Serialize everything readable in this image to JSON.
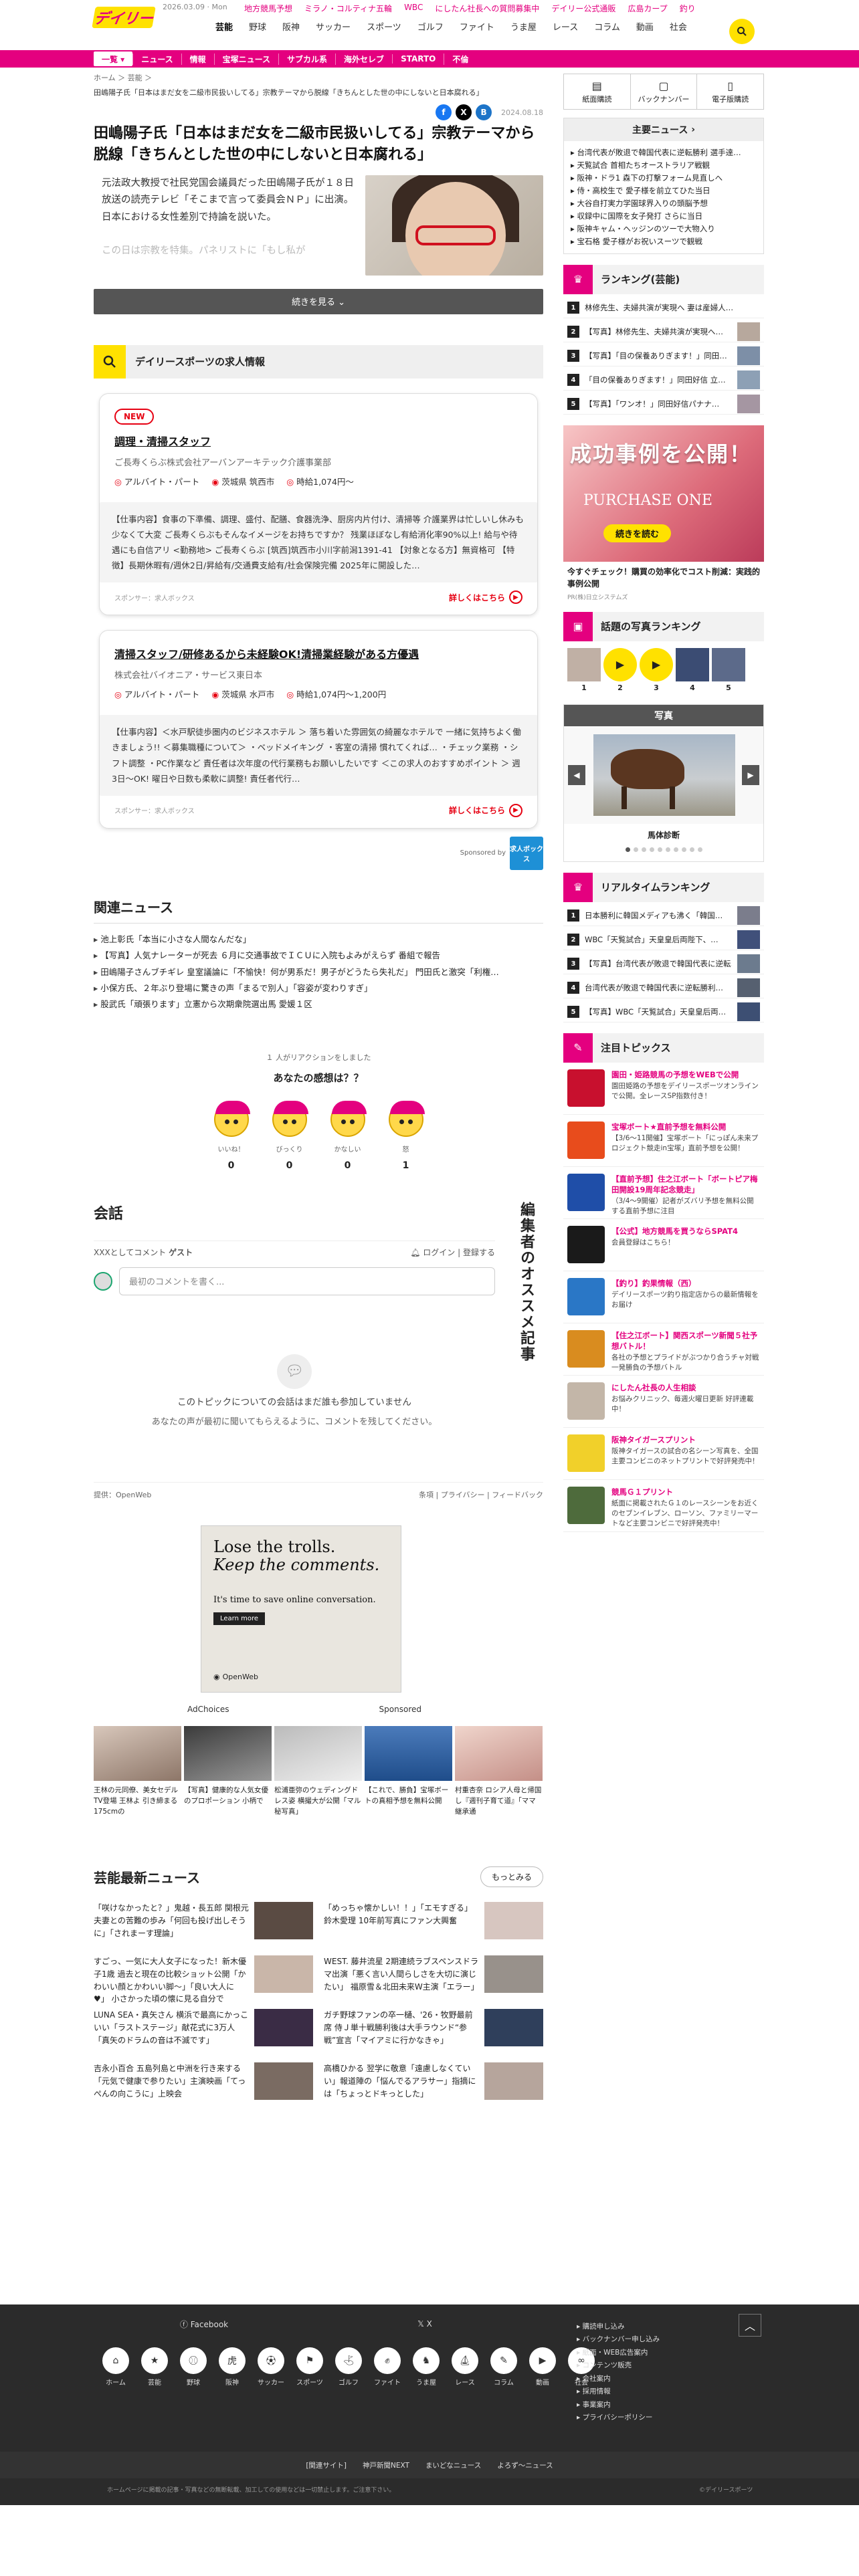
{
  "header": {
    "logo_text": "デイリー",
    "date": "2026.03.09 · Mon",
    "top_links": [
      "地方競馬予想",
      "ミラノ・コルティナ五輪",
      "WBC",
      "にしたん社長への質問募集中",
      "デイリー公式通販",
      "広島カープ",
      "釣り"
    ],
    "gnav": [
      "芸能",
      "野球",
      "阪神",
      "サッカー",
      "スポーツ",
      "ゴルフ",
      "ファイト",
      "うま屋",
      "レース",
      "コラム",
      "動画",
      "社会"
    ],
    "pinkbar": [
      "一覧 ▾",
      "ニュース",
      "情報",
      "宝塚ニュース",
      "サブカル系",
      "海外セレブ",
      "STARTO",
      "不倫"
    ]
  },
  "article": {
    "breadcrumb": "ホーム ＞ 芸能 ＞",
    "breadcrumb_title": "田嶋陽子氏「日本はまだ女を二級市民扱いしてる」宗教テーマから脱線「きちんとした世の中にしないと日本腐れる」",
    "date": "2024.08.18",
    "headline": "田嶋陽子氏「日本はまだ女を二級市民扱いしてる」宗教テーマから脱線「きちんとした世の中にしないと日本腐れる」",
    "lead": "元法政大教授で社民党国会議員だった田嶋陽子氏が１８日放送の読売テレビ「そこまで言って委員会ＮＰ」に出演。日本における女性差別で持論を説いた。",
    "lead_fade": "この日は宗教を特集。パネリストに「もし私が",
    "continue": "続きを見る ⌄"
  },
  "jobs": {
    "title": "デイリースポーツの求人情報",
    "items": [
      {
        "badge": "NEW",
        "title": "調理・清掃スタッフ",
        "company": "ご長寿くらぶ株式会社アーバンアーキテック介護事業部",
        "type": "アルバイト・パート",
        "place": "茨城県 筑西市",
        "wage": "時給1,074円～",
        "desc": "【仕事内容】食事の下準備、調理、盛付、配膳、食器洗浄、厨房内片付け、清掃等 介護業界は忙しいし休みも少なくて大変 ご長寿くらぶもそんなイメージをお持ちですか？ 残業ほぼなし有給消化率90%以上! 給与や待遇にも自信アリ <勤務地> ご長寿くらぶ [筑西]筑西市小川字前潟1391-41 【対象となる方】無資格可 【特徴】長期休暇有/週休2日/昇給有/交通費支給有/社会保険完備 2025年に開設した…",
        "sponsor": "スポンサー：求人ボックス",
        "more": "詳しくはこちら"
      },
      {
        "badge": "",
        "title": "清掃スタッフ/研修あるから未経験OK!清掃業経験がある方優遇",
        "company": "株式会社バイオニア・サービス東日本",
        "type": "アルバイト・パート",
        "place": "茨城県 水戸市",
        "wage": "時給1,074円～1,200円",
        "desc": "【仕事内容】＜水戸駅徒歩圏内のビジネスホテル ＞ 落ち着いた雰囲気の綺麗なホテルで 一緒に気持ちよく働きましょう!! ＜募集職種について＞ ・ベッドメイキング ・客室の清掃 慣れてくれば… ・チェック業務 ・シフト調整 ・PC作業など 責任者は次年度の代行業務もお願いしたいです ＜この求人のおすすめポイント ＞ 週3日～OK! 曜日や日数も柔軟に調整! 責任者代行…",
        "sponsor": "スポンサー：求人ボックス",
        "more": "詳しくはこちら"
      }
    ],
    "sponsored_by": "Sponsored by",
    "sponsor_logo": "求人ボックス"
  },
  "related": {
    "title": "関連ニュース",
    "items": [
      "池上彰氏「本当に小さな人間なんだな」",
      "【写真】人気ナレーターが死去 ６月に交通事故でＩＣＵに入院もよみがえらず 番組で報告",
      "田嶋陽子さんブチギレ 皇室議論に「不愉快！何が男系だ！男子がどうたら失礼だ」 門田氏と激突「利権…",
      "小保方氏、２年ぶり登場に驚きの声「まるで別人」「容姿が変わりすぎ」",
      "股武氏「頑張ります」立憲から次期衆院選出馬 愛媛１区"
    ]
  },
  "reactions": {
    "count_text": "１ 人がリアクションをしました",
    "question": "あなたの感想は？？",
    "items": [
      {
        "label": "いいね！",
        "count": "0"
      },
      {
        "label": "びっくり",
        "count": "0"
      },
      {
        "label": "かなしい",
        "count": "0"
      },
      {
        "label": "怒",
        "count": "1"
      }
    ]
  },
  "comments": {
    "title": "会話",
    "user_label": "XXXとしてコメント",
    "user_name": "ゲスト",
    "login": "ログイン",
    "register": "登録する",
    "placeholder": "最初のコメントを書く...",
    "empty1": "このトピックについての会話はまだ誰も参加していません",
    "empty2": "あなたの声が最初に聞いてもらえるように、コメントを残してください。",
    "powered": "提供：OpenWeb",
    "footer_links": [
      "条項",
      "プライバシー",
      "フィードバック"
    ],
    "vertical": "編集者のオススメ記事"
  },
  "ad": {
    "headline1": "Lose the trolls.",
    "headline2": "Keep the comments.",
    "sub": "It's time to save online conversation.",
    "btn": "Learn more",
    "brand": "OpenWeb",
    "adchoices": "AdChoices",
    "sponsored": "Sponsored"
  },
  "thumbs": [
    "王林の元同僚、美女セデルTV登場 王林よ 引き締まる175cmの",
    "【写真】健康的な人気女優のプロポーション 小柄で",
    "松浦亜弥のウェディングドレス姿 横撮大が公開「マル秘写真」",
    "【これで、勝負】宝塚ボートの真相予想を無料公開",
    "村重杏奈 ロシア人母と帰国し『週刊子育て道』「ママ継承通"
  ],
  "latest": {
    "title": "芸能最新ニュース",
    "more": "もっとみる",
    "items": [
      "「咲けなかったと？」鬼越・長五郎 関根元夫妻との苦難の歩み「何回も投げ出しそうに」「されまーす理論」",
      "「めっちゃ懐かしい！！」「エモすぎる」鈴木愛理 10年前写真にファン大興奮",
      "すごっ、一気に大人女子になった！新木優子1歳 過去と現在の比較ショット公開「かわいい顔とかわいい脚～」「良い大人に♥」 小さかった頃の懐に見る自分で",
      "WEST. 藤井流星 2期連続ラブスペンスドラマ出演「悪く言い人間らしさを大切に演じたい」 福原雪＆北田未来W主演「エラー」",
      "LUNA SEA・真矢さん 横浜で最高にかっこいい「ラストステージ」献花式に3万人「真矢のドラムの音は不滅です」",
      "ガチ野球ファンの卒一樋、'26・牧野最前席 侍Ｊ単十戦勝利後は大手ラウンド“参戦”宣言「マイアミに行かなきゃ」",
      "吉永小百合 五島列島と中洲を行き来する「元気で健康で参りたい」主演映画「てっぺんの向こうに」上映会",
      "高橋ひかる 翌学に敬意「遠慮しなくていい」報道陣の「悩んでるアラサー」指摘には「ちょっとドキっとした」"
    ]
  },
  "sidebar": {
    "buttons": [
      "紙面購読",
      "バックナンバー",
      "電子版購読"
    ],
    "mainnews_title": "主要ニュース",
    "mainnews": [
      "台湾代表が敗退で韓国代表に逆転勝利 選手達…",
      "天覧試合 首相たちオーストラリア戦観",
      "阪神・ドラ1 森下の打撃フォーム見直しへ",
      "侍・高校生で 愛子様を前立てひた当日",
      "大谷自打実力学園球界入りの頭脳予想",
      "収録中に国際を女子発打 さらに当日",
      "阪神キャム・ヘッジンのツーで大物入り",
      "宝石格 愛子様がお祝いスーツで観戦"
    ],
    "ranking_title": "ランキング(芸能)",
    "ranking": [
      "林修先生、夫婦共演が実現へ 妻は産婦人…",
      "【写真】林修先生、夫婦共演が実現へ…",
      "【写真】「目の保養ありぎます！」同田…",
      "「目の保養ありぎます！」同田好信 立…",
      "【写真】「ワンオ！」同田好信パナナ…"
    ],
    "banner_big": "成功事例を公開！",
    "banner_brand": "PURCHASE ONE",
    "banner_cta": "続きを読む",
    "banner_text": "今すぐチェック！購買の効率化でコスト削減：実践的事例公開",
    "banner_small": "PR(株)日立システムズ",
    "photorank_title": "話題の写真ランキング",
    "photorank_nums": [
      "1",
      "2",
      "3",
      "4",
      "5"
    ],
    "photos_title": "写真",
    "photo_caption": "馬体診断",
    "realtime_title": "リアルタイムランキング",
    "realtime": [
      "日本勝利に韓国メディアも沸く「韓国…",
      "WBC「天覧試合」天皇皇后両陛下、…",
      "【写真】台湾代表が敗退で韓国代表に逆転…",
      "台湾代表が敗退で韓国代表に逆転勝利…",
      "【写真】WBC「天覧試合」天皇皇后両…"
    ],
    "topics_title": "注目トピックス",
    "topics": [
      {
        "t": "園田・姫路競馬の予想をWEBで公開",
        "d": "園田姫路の予想をデイリースポーツオンラインで公開。全レースSP指数付き！"
      },
      {
        "t": "宝塚ボート★直前予想を無料公開",
        "d": "【3/6～11開催】宝塚ボート「にっぽん未来プロジェクト競走in宝塚」直前予想を公開！"
      },
      {
        "t": "【直前予想】住之江ボート「ボートピア梅田開設19周年記念競走」",
        "d": "（3/4～9開催）記者がズバリ予想を無料公開する直前予想に注目"
      },
      {
        "t": "【公式】地方競馬を買うならSPAT4",
        "d": "会員登録はこちら！"
      },
      {
        "t": "【釣り】釣果情報（西）",
        "d": "デイリースポーツ釣り指定店からの最新情報をお届け"
      },
      {
        "t": "【住之江ボート】関西スポーツ新聞５社予想バトル！",
        "d": "各社の予想とプライドがぶつかり合うチャ対戦一発勝負の予想バトル"
      },
      {
        "t": "にしたん社長の人生相談",
        "d": "お悩みクリニック、毎週火曜日更新 好評連載中！"
      },
      {
        "t": "阪神タイガースプリント",
        "d": "阪神タイガースの試合の名シーン写真を、全国主要コンビニのネットプリントで好評発売中！"
      },
      {
        "t": "競馬Ｇ１プリント",
        "d": "紙面に掲載されたＧ１のレースシーンをお近くのセブンイレブン、ローソン、ファミリーマートなど主要コンビニで好評発売中！"
      }
    ]
  },
  "footer": {
    "facebook": "Facebook",
    "x": "X",
    "icons": [
      "ホーム",
      "芸能",
      "野球",
      "阪神",
      "サッカー",
      "スポーツ",
      "ゴルフ",
      "ファイト",
      "うま屋",
      "レース",
      "コラム",
      "動画",
      "社会"
    ],
    "links": [
      "購読申し込み",
      "バックナンバー申し込み",
      "紙面・WEB広告案内",
      "コンテンツ販売",
      "会社案内",
      "採用情報",
      "事業案内",
      "プライバシーポリシー"
    ],
    "bar": [
      "[関連サイト]",
      "神戸新聞NEXT",
      "まいどなニュース",
      "よろず～ニュース"
    ],
    "copyright": "ホームページに掲載の記事・写真などの無断転載、加工しての使用などは一切禁止します。ご注意下さい。",
    "copyright2": "©デイリースポーツ"
  }
}
